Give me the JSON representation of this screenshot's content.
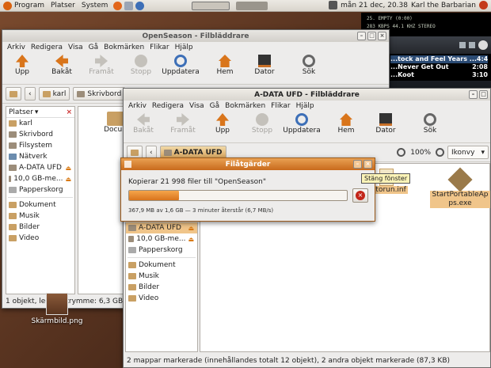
{
  "top_panel": {
    "menus": [
      "Program",
      "Platser",
      "System"
    ],
    "clock": "mån 21 dec, 20.38",
    "user": "Karl the Barbarian"
  },
  "media_player": {
    "track_line": "25. EMPTY (0:00)",
    "info_line": "283 KBPS 44.1 KHZ STEREO",
    "playlist": [
      {
        "title": "...tock and Feel Years ...",
        "time": "4:41"
      },
      {
        "title": "...Never Get Out",
        "time": "2:08"
      },
      {
        "title": "...Koot",
        "time": "3:10"
      }
    ]
  },
  "back_window": {
    "title": "OpenSeason - Filbläddrare",
    "menu": [
      "Arkiv",
      "Redigera",
      "Visa",
      "Gå",
      "Bokmärken",
      "Flikar",
      "Hjälp"
    ],
    "toolbar": {
      "back": "Bakåt",
      "forward": "Framåt",
      "stop": "Stopp",
      "up": "Upp",
      "refresh": "Uppdatera",
      "home": "Hem",
      "computer": "Dator",
      "search": "Sök"
    },
    "crumbs": [
      "karl",
      "Skrivbord"
    ],
    "sidebar_title": "Platser",
    "sidebar_items": [
      "karl",
      "Skrivbord",
      "Filsystem",
      "Nätverk",
      "A-DATA UFD",
      "10,0 GB-me...",
      "Papperskorg",
      "Dokument",
      "Musik",
      "Bilder",
      "Video"
    ],
    "file_label": "Docum",
    "status": "1 objekt, ledigt utrymme: 6,3 GB"
  },
  "desktop_icon": {
    "label": "Skärmbild.png"
  },
  "front_window": {
    "title": "A-DATA UFD - Filbläddrare",
    "menu": [
      "Arkiv",
      "Redigera",
      "Visa",
      "Gå",
      "Bokmärken",
      "Flikar",
      "Hjälp"
    ],
    "toolbar": {
      "back": "Bakåt",
      "forward": "Framåt",
      "up": "Upp",
      "stop": "Stopp",
      "refresh": "Uppdatera",
      "home": "Hem",
      "computer": "Dator",
      "search": "Sök"
    },
    "crumb": "A-DATA UFD",
    "zoom": "100%",
    "view_mode": "Ikonvy",
    "sidebar_items": [
      "A-DATA UFD",
      "10,0 GB-me...",
      "Papperskorg",
      "Dokument",
      "Musik",
      "Bilder",
      "Video"
    ],
    "files": [
      "autorun.inf",
      "StartPortableApps.exe"
    ],
    "status": "2 mappar markerade (innehållandes totalt 12 objekt), 2 andra objekt markerade (87,3 KB)"
  },
  "progress_dialog": {
    "title": "Filåtgärder",
    "message": "Kopierar 21 998 filer till \"OpenSeason\"",
    "detail": "367,9 MB av 1,6 GB — 3 minuter återstår (6,7 MB/s)",
    "progress_fraction": 0.23,
    "tooltip": "Stäng fönster"
  },
  "colors": {
    "accent": "#e07f2a",
    "selection": "#f0c58a",
    "panel": "#dedad3"
  }
}
